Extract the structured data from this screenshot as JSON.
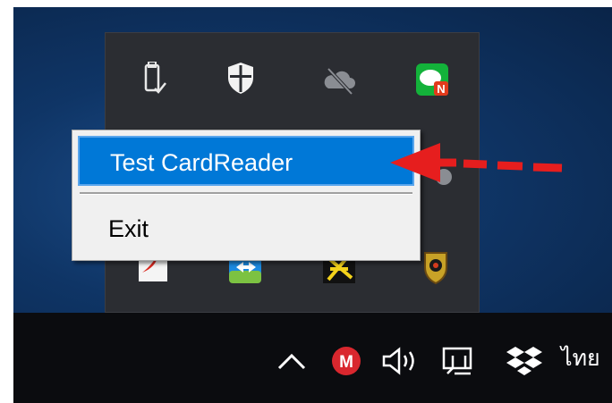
{
  "context_menu": {
    "items": [
      {
        "label": "Test CardReader",
        "selected": true
      },
      {
        "label": "Exit",
        "selected": false
      }
    ]
  },
  "tray_flyout_icons": [
    "usb-safe-remove-icon",
    "windows-defender-shield-icon",
    "onedrive-offline-cloud-icon",
    "line-messenger-icon",
    "acrobat-icon",
    "teamviewer-icon",
    "app-yellow-black-icon",
    "emblem-crest-icon"
  ],
  "taskbar": {
    "icons": [
      "show-hidden-icons-chevron-icon",
      "mega-icon",
      "volume-icon",
      "network-icon",
      "dropbox-icon"
    ],
    "input_language": "ไทย"
  },
  "annotation": {
    "arrow_color": "#e61e1e"
  },
  "colors": {
    "menu_highlight": "#0078d7",
    "desktop_blue": "#0f3566",
    "taskbar": "#0b0c0f"
  }
}
